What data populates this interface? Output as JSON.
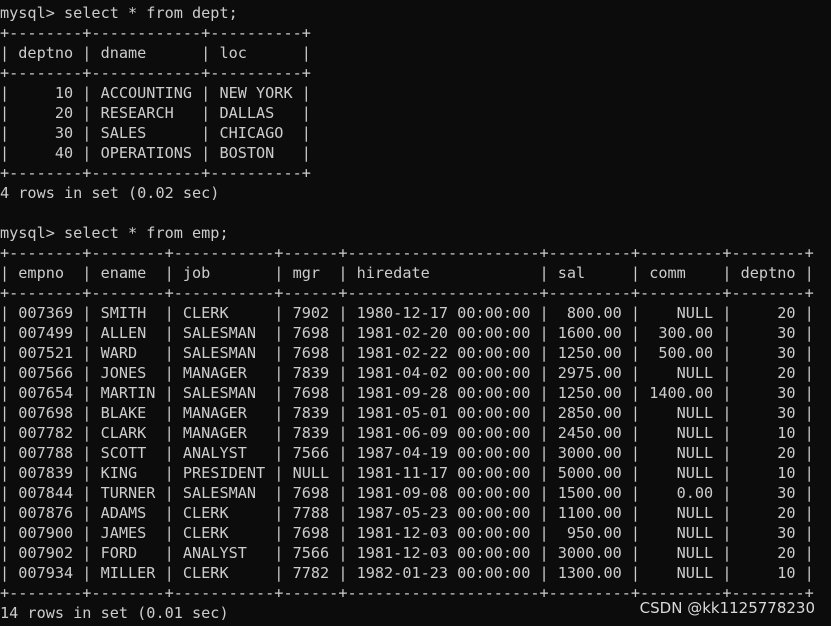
{
  "terminal": {
    "lines": [
      "mysql> select * from dept;",
      "+--------+------------+----------+",
      "| deptno | dname      | loc      |",
      "+--------+------------+----------+",
      "|     10 | ACCOUNTING | NEW YORK |",
      "|     20 | RESEARCH   | DALLAS   |",
      "|     30 | SALES      | CHICAGO  |",
      "|     40 | OPERATIONS | BOSTON   |",
      "+--------+------------+----------+",
      "4 rows in set (0.02 sec)",
      "",
      "mysql> select * from emp;",
      "+--------+--------+-----------+------+---------------------+---------+---------+--------+",
      "| empno  | ename  | job       | mgr  | hiredate            | sal     | comm    | deptno |",
      "+--------+--------+-----------+------+---------------------+---------+---------+--------+",
      "| 007369 | SMITH  | CLERK     | 7902 | 1980-12-17 00:00:00 |  800.00 |    NULL |     20 |",
      "| 007499 | ALLEN  | SALESMAN  | 7698 | 1981-02-20 00:00:00 | 1600.00 |  300.00 |     30 |",
      "| 007521 | WARD   | SALESMAN  | 7698 | 1981-02-22 00:00:00 | 1250.00 |  500.00 |     30 |",
      "| 007566 | JONES  | MANAGER   | 7839 | 1981-04-02 00:00:00 | 2975.00 |    NULL |     20 |",
      "| 007654 | MARTIN | SALESMAN  | 7698 | 1981-09-28 00:00:00 | 1250.00 | 1400.00 |     30 |",
      "| 007698 | BLAKE  | MANAGER   | 7839 | 1981-05-01 00:00:00 | 2850.00 |    NULL |     30 |",
      "| 007782 | CLARK  | MANAGER   | 7839 | 1981-06-09 00:00:00 | 2450.00 |    NULL |     10 |",
      "| 007788 | SCOTT  | ANALYST   | 7566 | 1987-04-19 00:00:00 | 3000.00 |    NULL |     20 |",
      "| 007839 | KING   | PRESIDENT | NULL | 1981-11-17 00:00:00 | 5000.00 |    NULL |     10 |",
      "| 007844 | TURNER | SALESMAN  | 7698 | 1981-09-08 00:00:00 | 1500.00 |    0.00 |     30 |",
      "| 007876 | ADAMS  | CLERK     | 7788 | 1987-05-23 00:00:00 | 1100.00 |    NULL |     20 |",
      "| 007900 | JAMES  | CLERK     | 7698 | 1981-12-03 00:00:00 |  950.00 |    NULL |     30 |",
      "| 007902 | FORD   | ANALYST   | 7566 | 1981-12-03 00:00:00 | 3000.00 |    NULL |     20 |",
      "| 007934 | MILLER | CLERK     | 7782 | 1982-01-23 00:00:00 | 1300.00 |    NULL |     10 |",
      "+--------+--------+-----------+------+---------------------+---------+---------+--------+",
      "14 rows in set (0.01 sec)"
    ]
  },
  "watermark": "CSDN @kk1125778230",
  "colors": {
    "background": "#0c0c0c",
    "text": "#cccccc"
  }
}
